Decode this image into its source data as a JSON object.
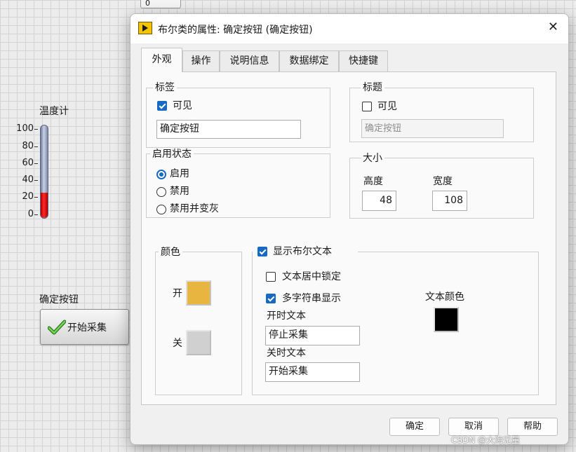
{
  "panel": {
    "top_indicator_value": "0",
    "thermometer": {
      "label": "温度计",
      "ticks": [
        "100",
        "80",
        "60",
        "40",
        "20",
        "0"
      ],
      "range": [
        0,
        100
      ],
      "value_fraction": 0.27,
      "fill_color": "#e00000"
    },
    "button": {
      "label": "确定按钮",
      "text": "开始采集"
    }
  },
  "dialog": {
    "title": "布尔类的属性: 确定按钮 (确定按钮)",
    "tabs": [
      {
        "label": "外观",
        "active": true
      },
      {
        "label": "操作",
        "active": false
      },
      {
        "label": "说明信息",
        "active": false
      },
      {
        "label": "数据绑定",
        "active": false
      },
      {
        "label": "快捷键",
        "active": false
      }
    ],
    "label_group": {
      "title": "标签",
      "visible_label": "可见",
      "visible": true,
      "value": "确定按钮"
    },
    "caption_group": {
      "title": "标题",
      "visible_label": "可见",
      "visible": false,
      "value": "确定按钮"
    },
    "enable_group": {
      "title": "启用状态",
      "options": [
        {
          "label": "启用",
          "selected": true
        },
        {
          "label": "禁用",
          "selected": false
        },
        {
          "label": "禁用并变灰",
          "selected": false
        }
      ]
    },
    "size_group": {
      "title": "大小",
      "height_label": "高度",
      "height": "48",
      "width_label": "宽度",
      "width": "108"
    },
    "color_group": {
      "title": "颜色",
      "on_label": "开",
      "on_color": "#e8b640",
      "off_label": "关",
      "off_color": "#d0d0d0"
    },
    "bool_text": {
      "show_label": "显示布尔文本",
      "show": true,
      "center_lock_label": "文本居中锁定",
      "center_lock": false,
      "multi_string_label": "多字符串显示",
      "multi_string": true,
      "on_text_label": "开时文本",
      "on_text": "停止采集",
      "off_text_label": "关时文本",
      "off_text": "开始采集",
      "text_color_label": "文本颜色",
      "text_color": "#000000"
    },
    "buttons": {
      "ok": "确定",
      "cancel": "取消",
      "help": "帮助"
    }
  },
  "watermark": "CSDN @大海无量",
  "accent": "#1769c1"
}
